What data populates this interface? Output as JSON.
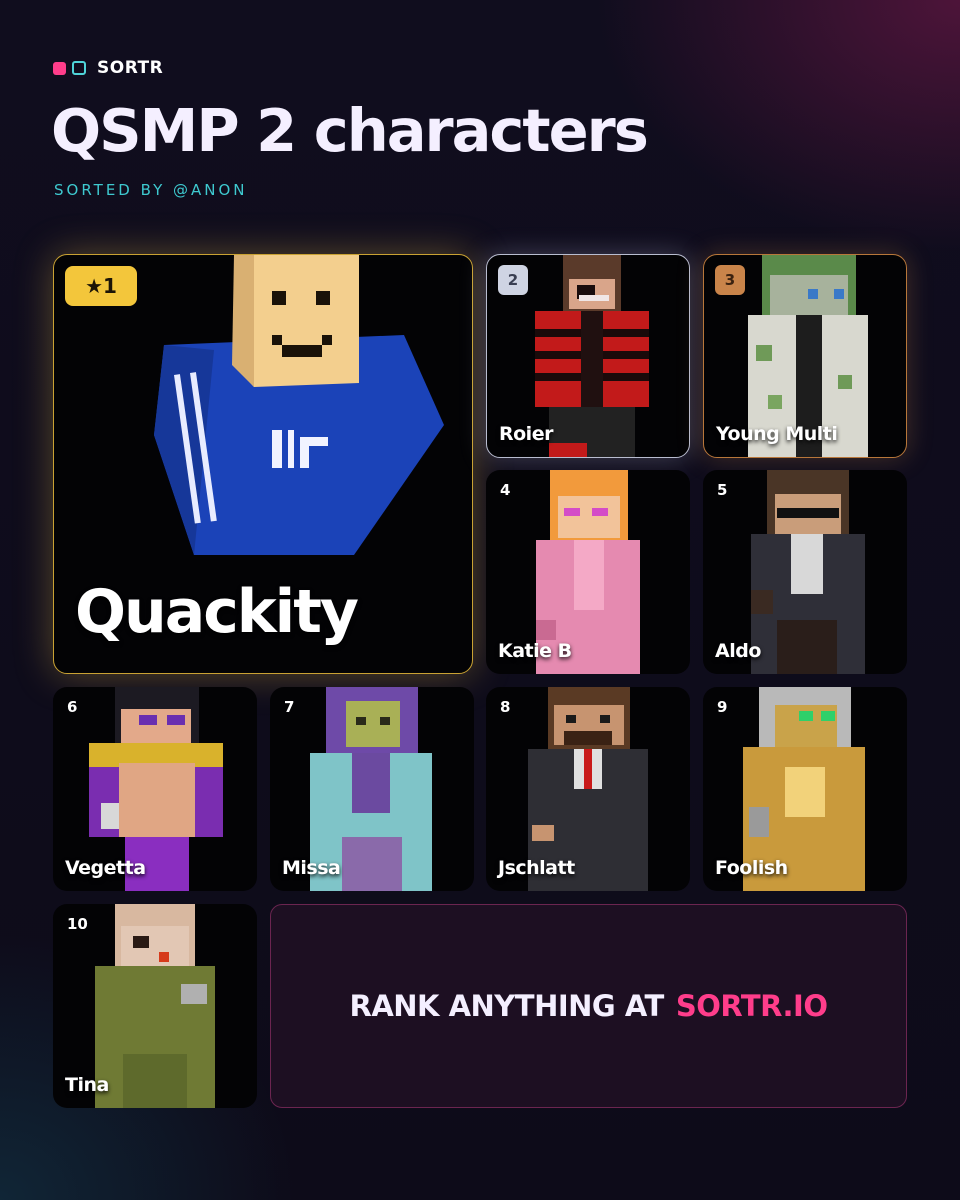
{
  "brand": {
    "name": "SORTR"
  },
  "header": {
    "title": "QSMP 2 characters",
    "subtitle": "SORTED BY @ANON"
  },
  "entries": [
    {
      "rank": "★1",
      "name": "Quackity"
    },
    {
      "rank": "2",
      "name": "Roier"
    },
    {
      "rank": "3",
      "name": "Young Multi"
    },
    {
      "rank": "4",
      "name": "Katie B"
    },
    {
      "rank": "5",
      "name": "Aldo"
    },
    {
      "rank": "6",
      "name": "Vegetta"
    },
    {
      "rank": "7",
      "name": "Missa"
    },
    {
      "rank": "8",
      "name": "Jschlatt"
    },
    {
      "rank": "9",
      "name": "Foolish"
    },
    {
      "rank": "10",
      "name": "Tina"
    }
  ],
  "cta": {
    "text": "RANK ANYTHING AT",
    "link": "SORTR.IO"
  },
  "colors": {
    "accent_pink": "#ff3d8b",
    "accent_cyan": "#3ec9cf",
    "gold": "#f3c63b",
    "silver": "#cfd4e3",
    "bronze": "#c9844a"
  }
}
